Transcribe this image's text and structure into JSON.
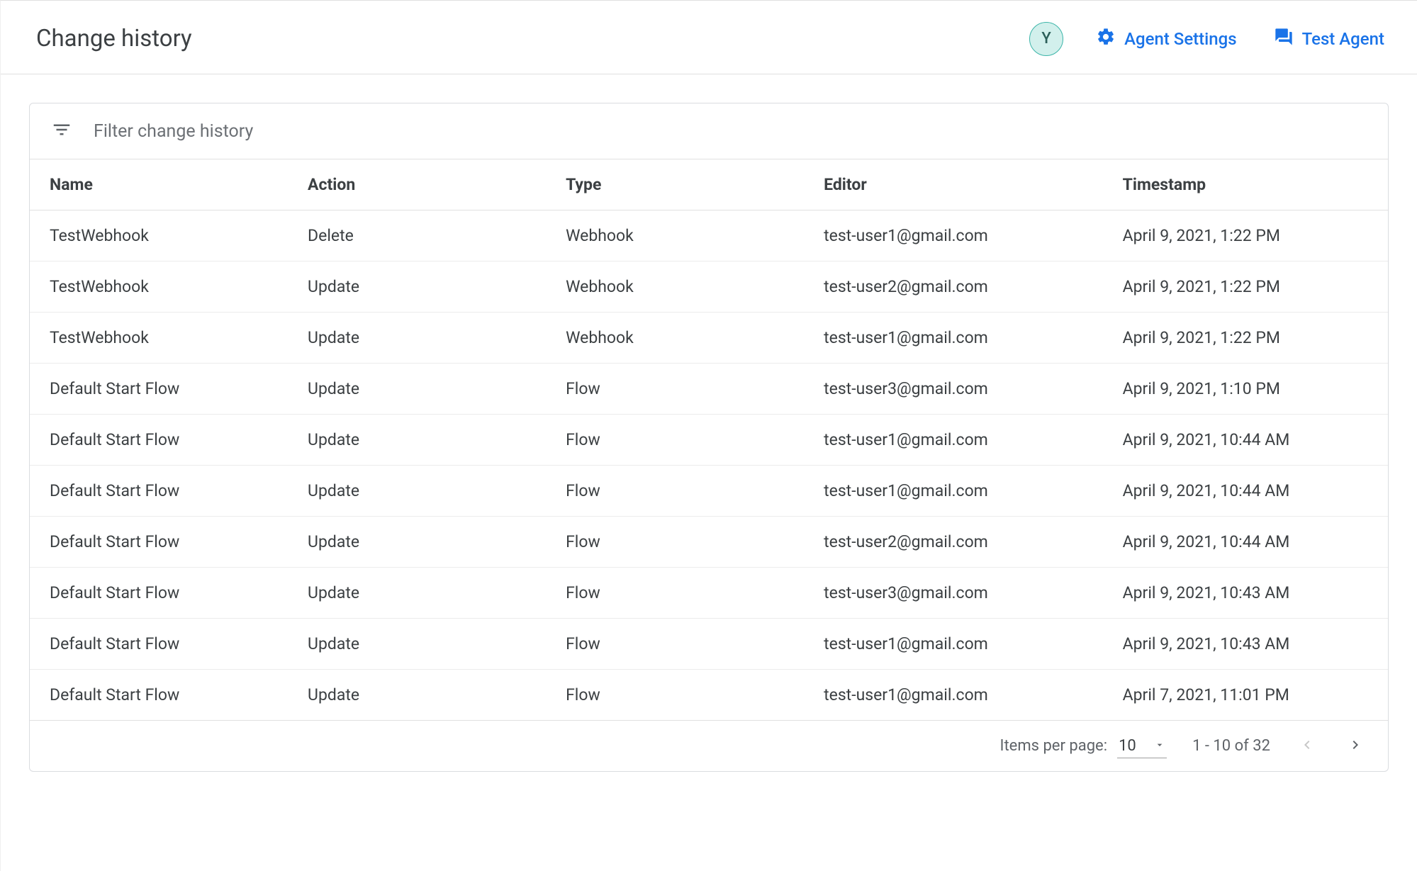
{
  "header": {
    "title": "Change history",
    "avatar_initial": "Y",
    "agent_settings_label": "Agent Settings",
    "test_agent_label": "Test Agent"
  },
  "filter": {
    "placeholder": "Filter change history"
  },
  "table": {
    "columns": {
      "name": "Name",
      "action": "Action",
      "type": "Type",
      "editor": "Editor",
      "timestamp": "Timestamp"
    },
    "rows": [
      {
        "name": "TestWebhook",
        "action": "Delete",
        "type": "Webhook",
        "editor": "test-user1@gmail.com",
        "timestamp": "April 9, 2021, 1:22 PM"
      },
      {
        "name": "TestWebhook",
        "action": "Update",
        "type": "Webhook",
        "editor": "test-user2@gmail.com",
        "timestamp": "April 9, 2021, 1:22 PM"
      },
      {
        "name": "TestWebhook",
        "action": "Update",
        "type": "Webhook",
        "editor": "test-user1@gmail.com",
        "timestamp": "April 9, 2021, 1:22 PM"
      },
      {
        "name": "Default Start Flow",
        "action": "Update",
        "type": "Flow",
        "editor": "test-user3@gmail.com",
        "timestamp": "April 9, 2021, 1:10 PM"
      },
      {
        "name": "Default Start Flow",
        "action": "Update",
        "type": "Flow",
        "editor": "test-user1@gmail.com",
        "timestamp": "April 9, 2021, 10:44 AM"
      },
      {
        "name": "Default Start Flow",
        "action": "Update",
        "type": "Flow",
        "editor": "test-user1@gmail.com",
        "timestamp": "April 9, 2021, 10:44 AM"
      },
      {
        "name": "Default Start Flow",
        "action": "Update",
        "type": "Flow",
        "editor": "test-user2@gmail.com",
        "timestamp": "April 9, 2021, 10:44 AM"
      },
      {
        "name": "Default Start Flow",
        "action": "Update",
        "type": "Flow",
        "editor": "test-user3@gmail.com",
        "timestamp": "April 9, 2021, 10:43 AM"
      },
      {
        "name": "Default Start Flow",
        "action": "Update",
        "type": "Flow",
        "editor": "test-user1@gmail.com",
        "timestamp": "April 9, 2021, 10:43 AM"
      },
      {
        "name": "Default Start Flow",
        "action": "Update",
        "type": "Flow",
        "editor": "test-user1@gmail.com",
        "timestamp": "April 7, 2021, 11:01 PM"
      }
    ]
  },
  "pagination": {
    "items_per_page_label": "Items per page:",
    "items_per_page_value": "10",
    "range_label": "1 - 10 of 32"
  }
}
